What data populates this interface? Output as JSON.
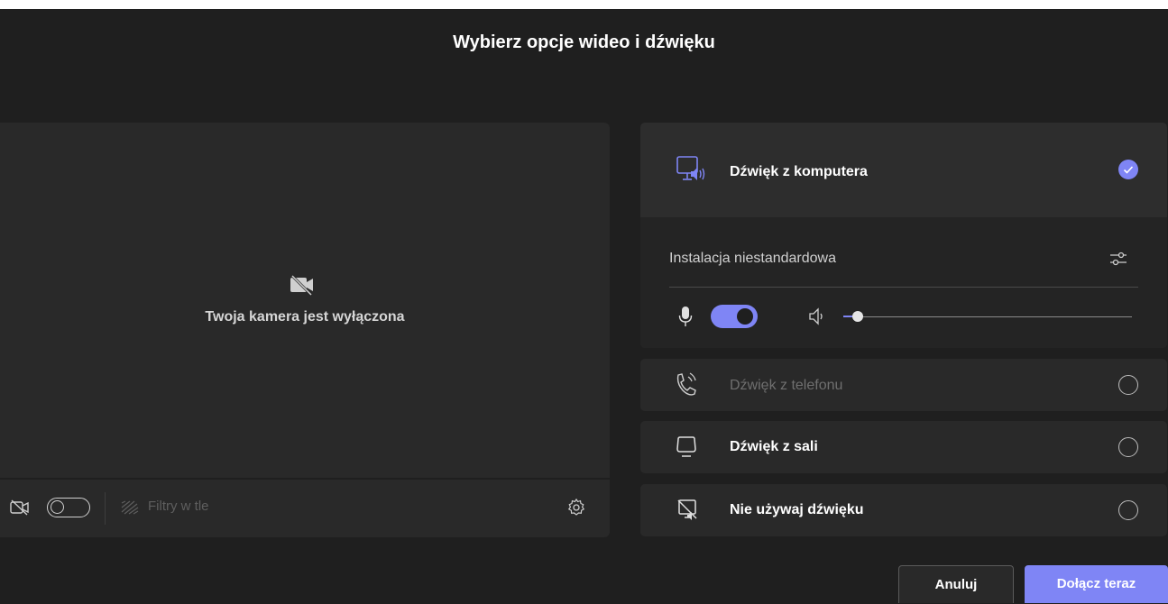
{
  "dialog": {
    "title": "Wybierz opcje wideo i dźwięku"
  },
  "video": {
    "camera_off_text": "Twoja kamera jest wyłączona",
    "camera_toggle": "off",
    "filters_label": "Filtry w tle"
  },
  "audio": {
    "options": [
      {
        "label": "Dźwięk z komputera",
        "selected": true,
        "icon": "computer-audio-icon"
      },
      {
        "label": "Dźwięk z telefonu",
        "selected": false,
        "disabled": true,
        "icon": "phone-audio-icon"
      },
      {
        "label": "Dźwięk z sali",
        "selected": false,
        "icon": "room-audio-icon"
      },
      {
        "label": "Nie używaj dźwięku",
        "selected": false,
        "icon": "no-audio-icon"
      }
    ],
    "custom_setup_label": "Instalacja niestandardowa",
    "mic_toggle": "on",
    "speaker_volume": 0.05
  },
  "buttons": {
    "cancel": "Anuluj",
    "join": "Dołącz teraz"
  },
  "colors": {
    "accent": "#7f85f5",
    "background": "#1f1f1f",
    "panel": "#292929"
  }
}
